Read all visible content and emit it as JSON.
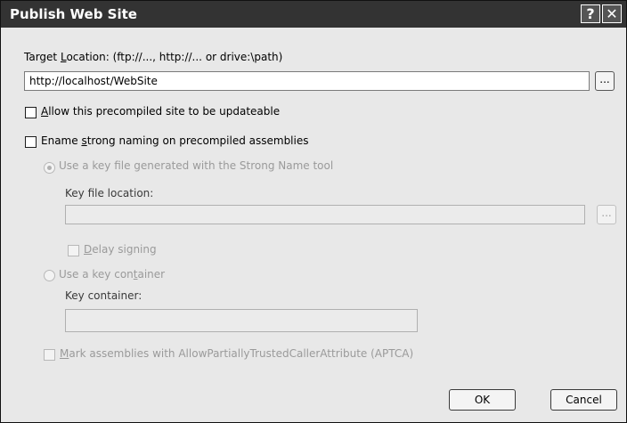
{
  "window": {
    "title": "Publish Web Site",
    "help_glyph": "?",
    "close_glyph": "✕"
  },
  "target": {
    "label_pre": "Target ",
    "label_key": "L",
    "label_post": "ocation: (ftp://..., http://... or drive:\\path)",
    "value": "http://localhost/WebSite",
    "browse_label": "..."
  },
  "updateable": {
    "label_key": "A",
    "label_post": "llow this precompiled site to be updateable",
    "checked": false
  },
  "strong_naming": {
    "label_pre": "Ename ",
    "label_key": "s",
    "label_post": "trong naming on precompiled assemblies",
    "checked": false
  },
  "key_file": {
    "radio_label": "Use a key file generated with the Strong Name tool",
    "selected": true,
    "location_label": "Key file location:",
    "location_value": "",
    "browse_label": "...",
    "delay_key": "D",
    "delay_post": "elay signing"
  },
  "key_container": {
    "radio_pre": "Use a key con",
    "radio_key": "t",
    "radio_post": "ainer",
    "selected": false,
    "label": "Key container:",
    "value": ""
  },
  "aptca": {
    "label_key": "M",
    "label_post": "ark assemblies with AllowPartiallyTrustedCallerAttribute (APTCA)",
    "checked": false
  },
  "buttons": {
    "ok": "OK",
    "cancel": "Cancel"
  }
}
